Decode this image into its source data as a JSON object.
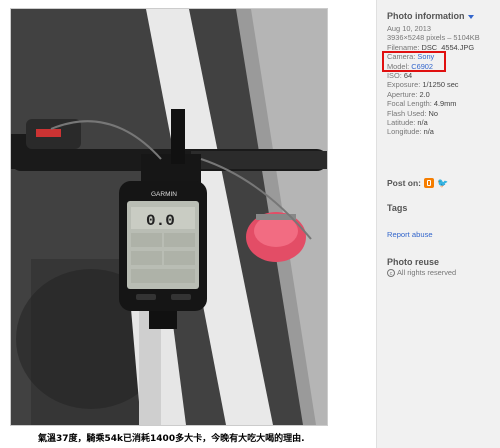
{
  "photo": {
    "caption": "氣溫37度，騎乘54k已消耗1400多大卡，今晚有大吃大喝的理由.",
    "device_brand": "GARMIN",
    "screen_reading": "0.0"
  },
  "sidebar": {
    "info_title": "Photo information",
    "date": "Aug 10, 2013",
    "dimensions": "3936×5248 pixels – 5104KB",
    "filename_label": "Filename:",
    "filename_value": "DSC_4554.JPG",
    "camera_label": "Camera:",
    "camera_value": "Sony",
    "model_label": "Model:",
    "model_value": "C6902",
    "iso_label": "ISO:",
    "iso_value": "64",
    "exposure_label": "Exposure:",
    "exposure_value": "1/1250 sec",
    "aperture_label": "Aperture:",
    "aperture_value": "2.0",
    "focal_label": "Focal Length:",
    "focal_value": "4.9mm",
    "flash_label": "Flash Used:",
    "flash_value": "No",
    "latitude_label": "Latitude:",
    "latitude_value": "n/a",
    "longitude_label": "Longitude:",
    "longitude_value": "n/a",
    "post_on_label": "Post on:",
    "tags_title": "Tags",
    "report_abuse": "Report abuse",
    "reuse_title": "Photo reuse",
    "rights": "All rights reserved"
  },
  "colors": {
    "link": "#3366cc",
    "highlight": "#e01010",
    "sidebar_bg": "#f1f1f1"
  }
}
